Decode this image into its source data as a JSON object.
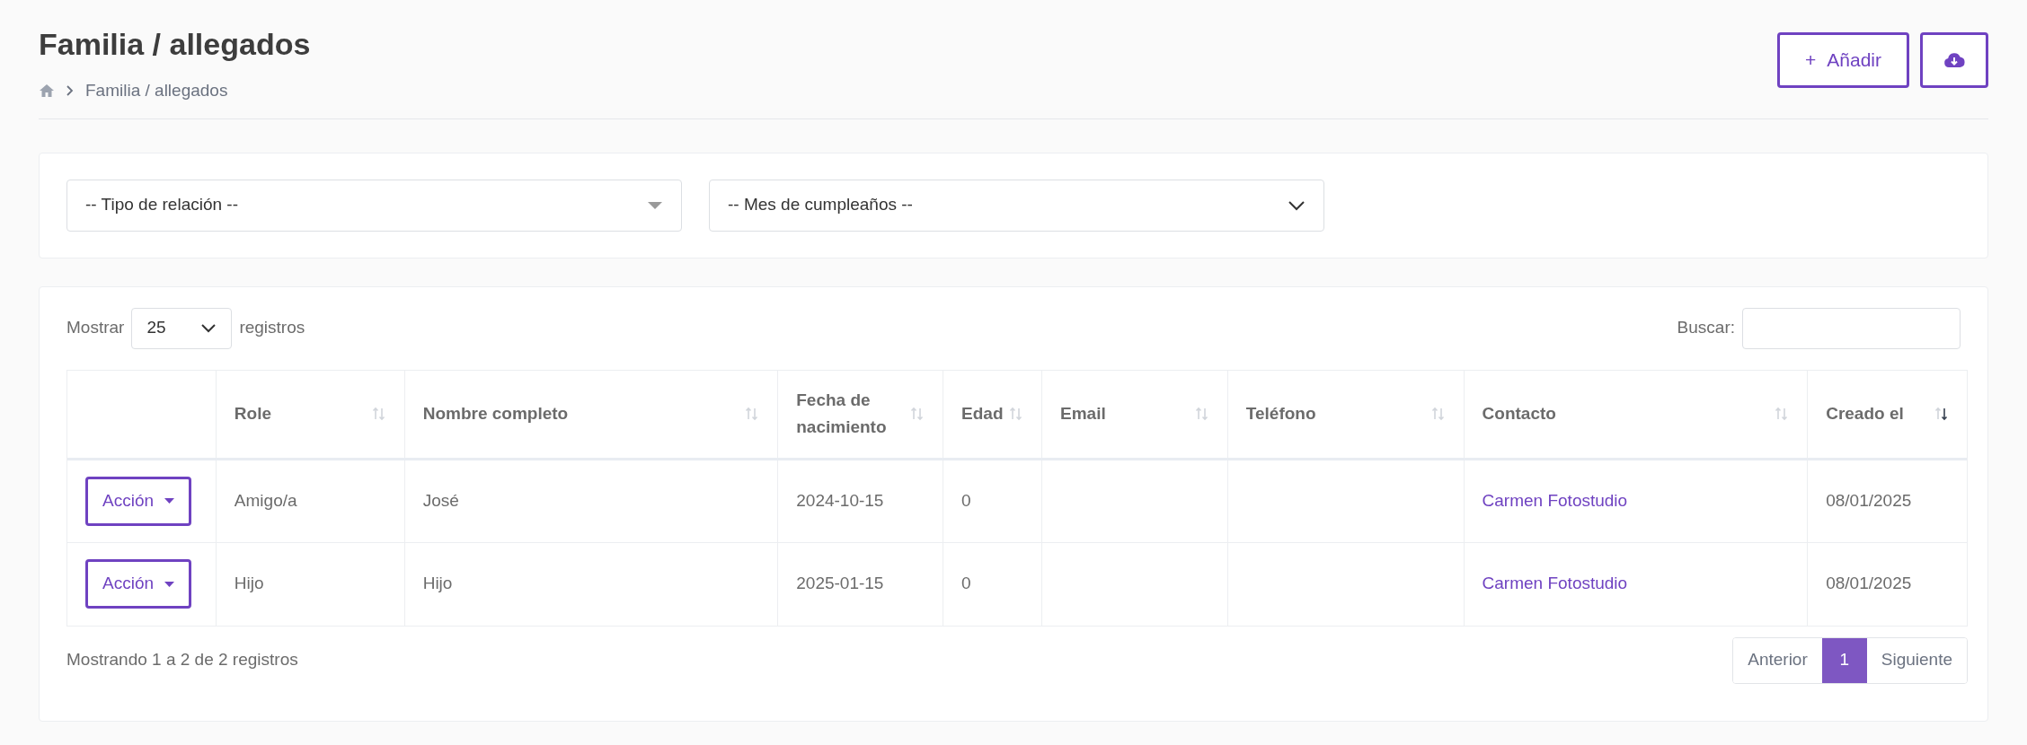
{
  "page": {
    "title": "Familia / allegados",
    "breadcrumb": [
      "Familia / allegados"
    ]
  },
  "header_actions": [
    {
      "kind": "add",
      "icon": "+",
      "label": "Añadir"
    },
    {
      "kind": "download"
    }
  ],
  "filters": [
    {
      "kind": "select2",
      "value": "-- Tipo de relación --"
    },
    {
      "kind": "native",
      "value": "-- Mes de cumpleaños --"
    }
  ],
  "table_controls": {
    "show_label": "Mostrar",
    "page_size": "25",
    "show_suffix": "registros",
    "search_label": "Buscar:"
  },
  "table": {
    "columns": [
      {
        "label": "Role",
        "sorted": false
      },
      {
        "label": "Nombre completo",
        "sorted": false
      },
      {
        "label": "Fecha de nacimiento",
        "sorted": false
      },
      {
        "label": "Edad",
        "sorted": false
      },
      {
        "label": "Email",
        "sorted": false
      },
      {
        "label": "Teléfono",
        "sorted": false
      },
      {
        "label": "Contacto",
        "sorted": false
      },
      {
        "label": "Creado el",
        "sorted": true
      }
    ],
    "rows": [
      {
        "action": "Acción",
        "role": "Amigo/a",
        "name": "José",
        "birth": "2024-10-15",
        "age": "0",
        "contact": "Carmen Fotostudio",
        "created": "08/01/2025"
      },
      {
        "action": "Acción",
        "role": "Hijo",
        "name": "Hijo",
        "birth": "2025-01-15",
        "age": "0",
        "contact": "Carmen Fotostudio",
        "created": "08/01/2025"
      }
    ]
  },
  "footer": {
    "info": "Mostrando 1 a 2 de 2 registros",
    "pagination": [
      {
        "label": "Anterior",
        "selected": false
      },
      {
        "label": "1",
        "selected": true
      },
      {
        "label": "Siguiente",
        "selected": false
      }
    ]
  }
}
